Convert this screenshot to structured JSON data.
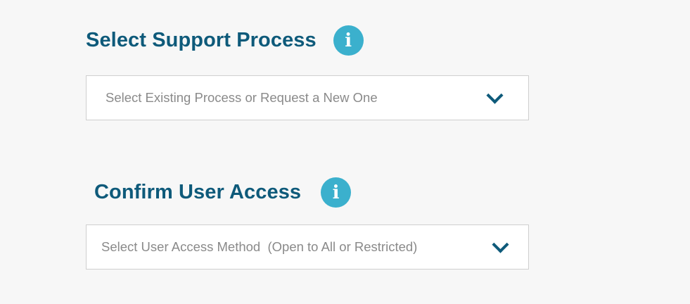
{
  "support_process": {
    "title": "Select Support Process",
    "info_icon": "i",
    "dropdown": {
      "placeholder": "Select Existing Process or Request a New One",
      "icon": "chevron-down-icon"
    }
  },
  "user_access": {
    "title": "Confirm User Access",
    "info_icon": "i",
    "dropdown": {
      "placeholder": "Select User Access Method  (Open to All or Restricted)",
      "icon": "chevron-down-icon"
    }
  },
  "colors": {
    "title": "#0e5a7a",
    "info_icon_bg": "#3bb0cd",
    "placeholder_text": "#8a8a8a",
    "background": "#f7f7f7"
  }
}
